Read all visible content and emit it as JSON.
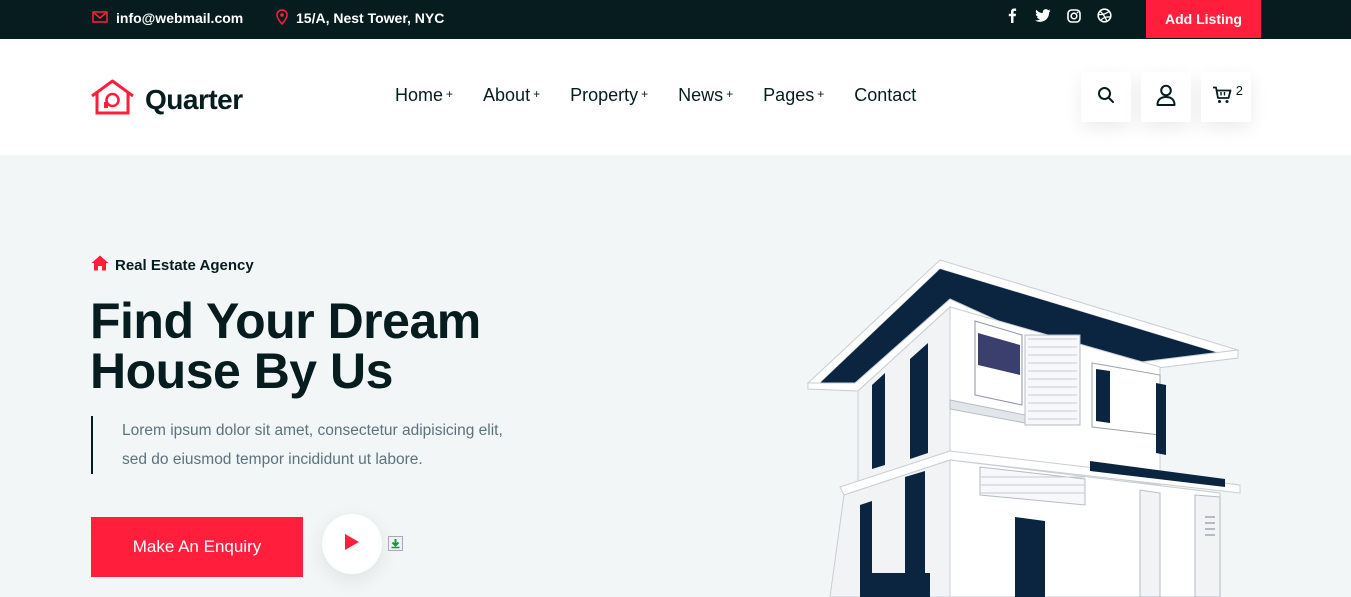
{
  "topbar": {
    "email": "info@webmail.com",
    "address": "15/A, Nest Tower, NYC",
    "socials": [
      "facebook-icon",
      "twitter-icon",
      "instagram-icon",
      "dribbble-icon"
    ],
    "add_listing": "Add Listing"
  },
  "header": {
    "logo": "Quarter",
    "nav": [
      {
        "label": "Home",
        "has_sub": true
      },
      {
        "label": "About",
        "has_sub": true
      },
      {
        "label": "Property",
        "has_sub": true
      },
      {
        "label": "News",
        "has_sub": true
      },
      {
        "label": "Pages",
        "has_sub": true
      },
      {
        "label": "Contact",
        "has_sub": false
      }
    ],
    "plus": "+",
    "cart_count": "2"
  },
  "hero": {
    "tag": "Real Estate Agency",
    "title_line1": "Find Your Dream",
    "title_line2": "House By Us",
    "desc_line1": "Lorem ipsum dolor sit amet, consectetur adipisicing elit,",
    "desc_line2": "sed do eiusmod tempor incididunt ut labore.",
    "button": "Make An Enquiry"
  },
  "colors": {
    "accent": "#ff1e3c",
    "dark": "#071c1f",
    "hero_bg": "#f2f6f7",
    "muted_text": "#5c727d"
  }
}
